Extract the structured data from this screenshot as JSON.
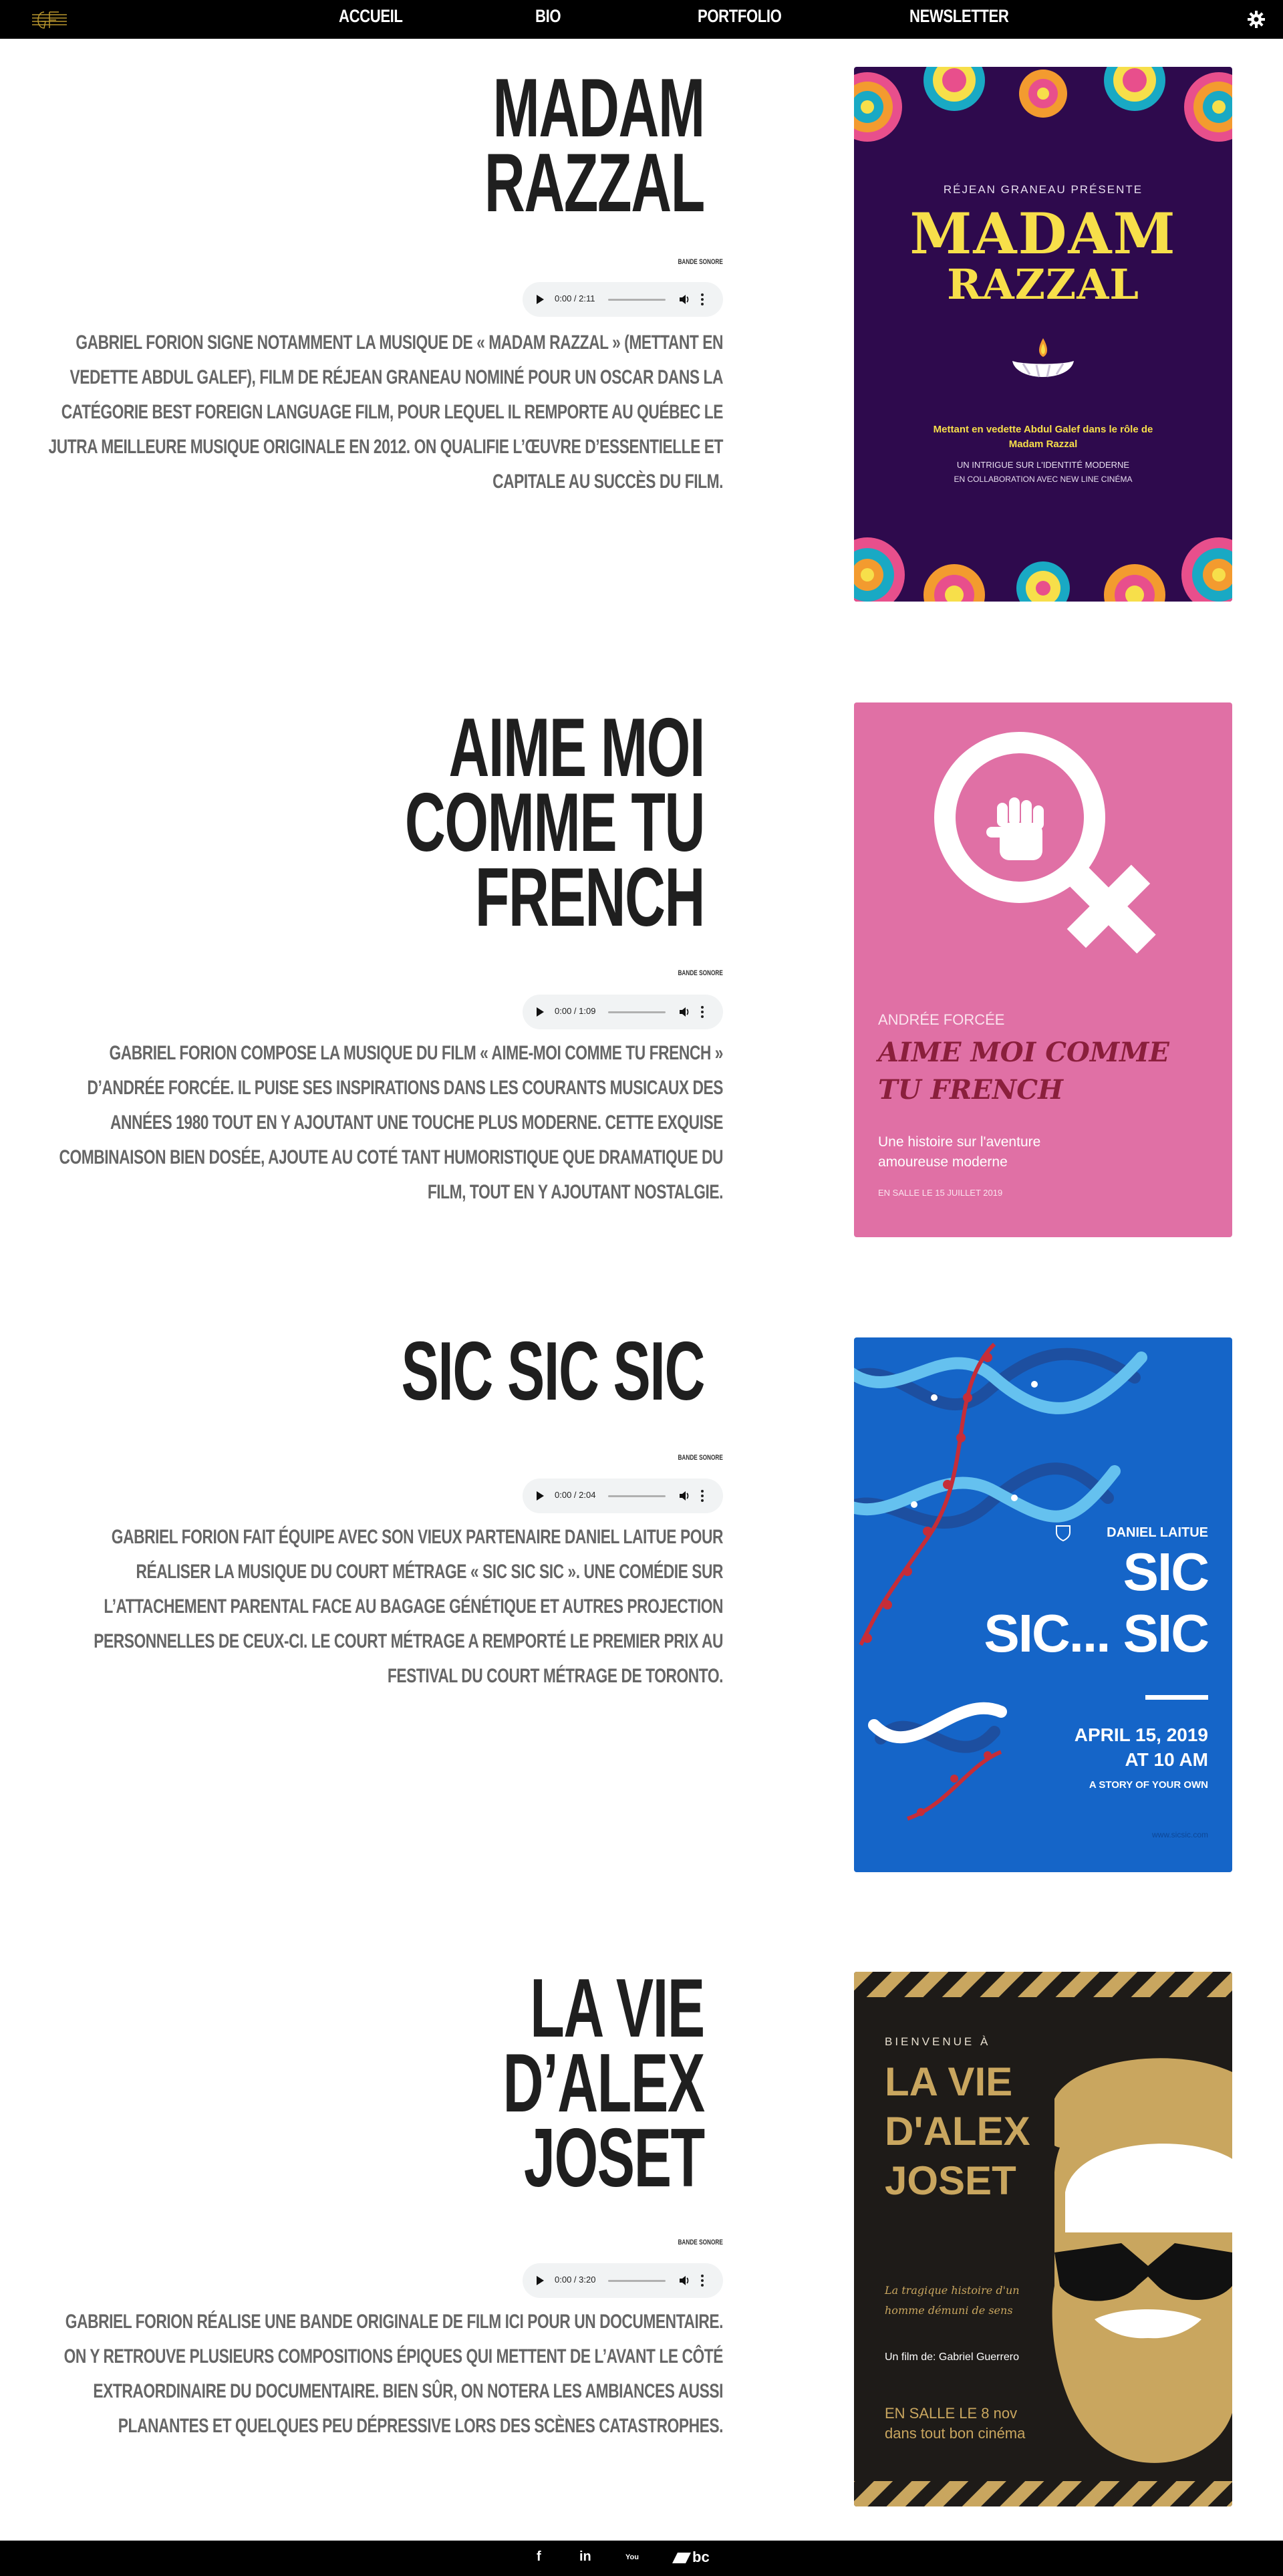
{
  "nav": {
    "logo": "GF",
    "links": [
      "ACCUEIL",
      "BIO",
      "PORTFOLIO",
      "NEWSLETTER"
    ]
  },
  "sections": [
    {
      "title_lines": [
        "MADAM",
        "RAZZAL"
      ],
      "bande_label": "BANDE SONORE",
      "audio_time": "0:00 / 2:11",
      "description": "GABRIEL FORION SIGNE NOTAMMENT LA MUSIQUE DE « MADAM RAZZAL » (METTANT EN VEDETTE ABDUL GALEF), FILM DE RÉJEAN GRANEAU NOMINÉ POUR UN OSCAR DANS LA CATÉGORIE BEST FOREIGN LANGUAGE FILM, POUR LEQUEL IL REMPORTE AU QUÉBEC LE JUTRA MEILLEURE MUSIQUE ORIGINALE EN 2012. ON QUALIFIE L’ŒUVRE D’ESSENTIELLE ET CAPITALE AU SUCCÈS DU FILM.",
      "poster": {
        "presenter": "RÉJEAN GRANEAU PRÉSENTE",
        "title1": "MADAM",
        "title2": "RAZZAL",
        "line1": "Mettant en vedette Abdul Galef dans le rôle de",
        "line2": "Madam Razzal",
        "line3": "UN INTRIGUE SUR L'IDENTITÉ MODERNE",
        "line4": "EN COLLABORATION AVEC NEW LINE CINÉMA"
      }
    },
    {
      "title_lines": [
        "AIME MOI",
        "COMME TU",
        "FRENCH"
      ],
      "bande_label": "BANDE SONORE",
      "audio_time": "0:00 / 1:09",
      "description": "GABRIEL FORION COMPOSE LA MUSIQUE DU FILM « AIME-MOI COMME TU FRENCH » D’ANDRÉE FORCÉE. IL PUISE SES INSPIRATIONS DANS LES COURANTS MUSICAUX DES ANNÉES 1980 TOUT EN Y AJOUTANT UNE TOUCHE PLUS MODERNE. CETTE EXQUISE COMBINAISON BIEN DOSÉE, AJOUTE AU COTÉ TANT HUMORISTIQUE QUE DRAMATIQUE DU FILM, TOUT EN Y AJOUTANT NOSTALGIE.",
      "poster": {
        "director": "ANDRÉE FORCÉE",
        "title1": "AIME MOI COMME",
        "title2": "TU FRENCH",
        "tag1": "Une histoire sur l'aventure",
        "tag2": "amoureuse moderne",
        "date": "EN SALLE LE 15 JUILLET 2019"
      }
    },
    {
      "title_lines": [
        "SIC SIC SIC"
      ],
      "bande_label": "BANDE SONORE",
      "audio_time": "0:00 / 2:04",
      "description": "GABRIEL FORION FAIT ÉQUIPE AVEC SON VIEUX PARTENAIRE DANIEL LAITUE POUR RÉALISER LA MUSIQUE DU COURT MÉTRAGE « SIC SIC SIC ». UNE COMÉDIE SUR L’ATTACHEMENT PARENTAL FACE AU BAGAGE GÉNÉTIQUE ET AUTRES PROJECTION PERSONNELLES DE CEUX-CI. LE COURT MÉTRAGE A REMPORTÉ LE PREMIER PRIX AU FESTIVAL DU COURT MÉTRAGE DE TORONTO.",
      "poster": {
        "director": "DANIEL LAITUE",
        "title1": "SIC",
        "title2": "SIC... SIC",
        "date1": "APRIL 15, 2019",
        "date2": "AT 10 AM",
        "tagline": "A STORY OF YOUR OWN",
        "url": "www.sicsic.com"
      }
    },
    {
      "title_lines": [
        "LA VIE",
        "D’ALEX",
        "JOSET"
      ],
      "bande_label": "BANDE SONORE",
      "audio_time": "0:00 / 3:20",
      "description": "GABRIEL FORION RÉALISE UNE BANDE ORIGINALE DE FILM ICI POUR UN DOCUMENTAIRE. ON Y RETROUVE PLUSIEURS COMPOSITIONS ÉPIQUES QUI METTENT DE L’AVANT LE CÔTÉ EXTRAORDINAIRE DU DOCUMENTAIRE. BIEN SÛR, ON NOTERA LES AMBIANCES AUSSI PLANANTES ET QUELQUES PEU DÉPRESSIVE LORS DES SCÈNES CATASTROPHES.",
      "poster": {
        "welcome": "BIENVENUE À",
        "title1": "LA VIE",
        "title2": "D'ALEX",
        "title3": "JOSET",
        "tag1": "La tragique histoire d'un",
        "tag2": "homme démuni de sens",
        "credit": "Un film de: Gabriel Guerrero",
        "date1": "EN SALLE LE 8 nov",
        "date2": "dans tout bon cinéma"
      }
    }
  ],
  "footer": {
    "icons": [
      "facebook-icon",
      "linkedin-icon",
      "youtube-icon",
      "bandcamp-icon"
    ],
    "youtube_label": "You",
    "bandcamp_label": "bc"
  },
  "colors": {
    "nav_bg": "#000000",
    "poster1_bg": "#2e0a4d",
    "poster1_gold": "#f7df4a",
    "poster2_bg": "#e070a5",
    "poster3_bg": "#1565c8",
    "poster4_bg": "#1e1b18",
    "poster4_gold": "#c9a65f"
  }
}
